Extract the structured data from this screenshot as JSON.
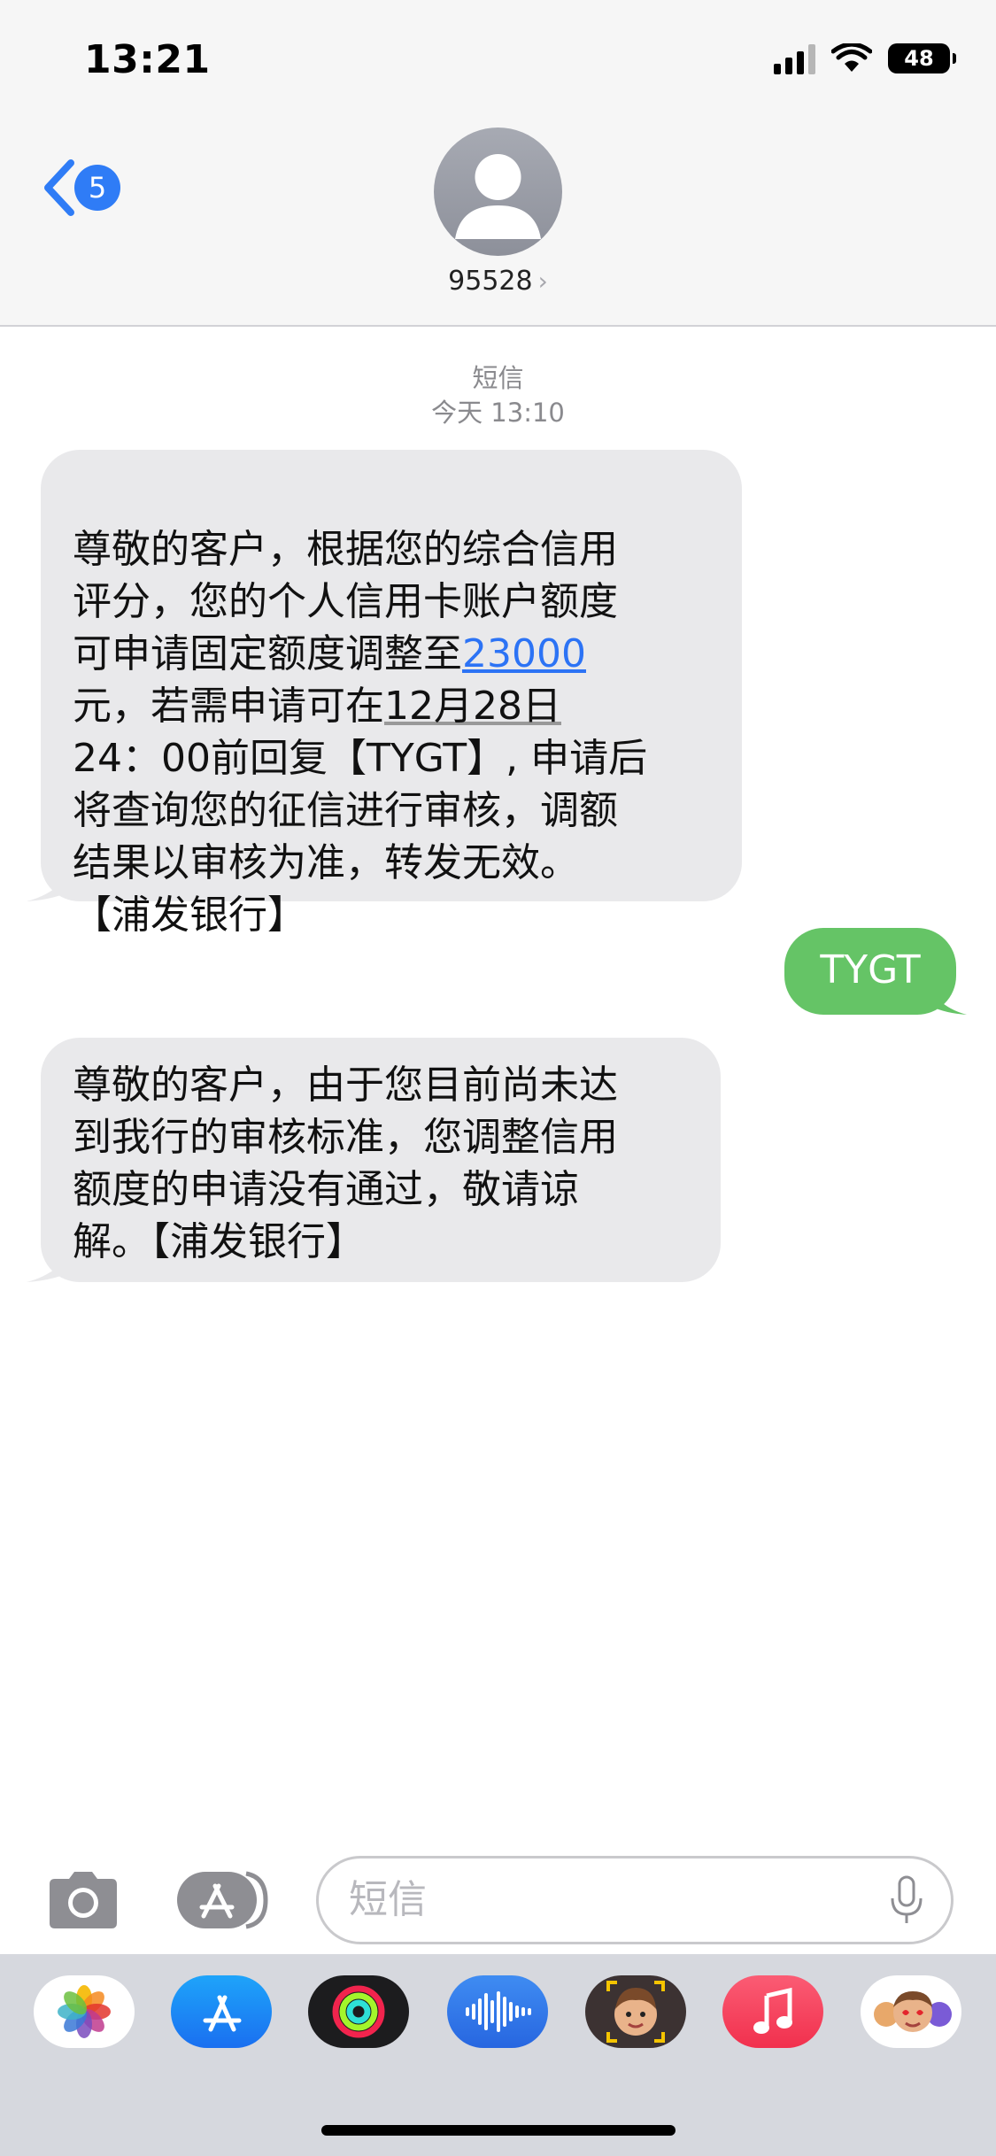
{
  "status": {
    "time": "13:21",
    "battery": "48"
  },
  "nav": {
    "back_badge": "5",
    "contact": "95528"
  },
  "thread": {
    "label": "短信",
    "time": "今天 13:10"
  },
  "messages": {
    "m1": {
      "p1": "尊敬的客户，根据您的综合信用\n评分，您的个人信用卡账户额度\n可申请固定额度调整至",
      "amount": "23000",
      "p2": "\n元，若需申请可在",
      "date": "12月28日",
      "p3": "\n24：00前回复【TYGT】, 申请后\n将查询您的征信进行审核，调额\n结果以审核为准，转发无效。\n【浦发银行】"
    },
    "m2": {
      "text": "TYGT"
    },
    "m3": {
      "text": "尊敬的客户，由于您目前尚未达\n到我行的审核标准，您调整信用\n额度的申请没有通过，敬请谅\n解。【浦发银行】"
    }
  },
  "input": {
    "placeholder": "短信"
  },
  "dock": [
    "photos-app",
    "app-store-app",
    "fitness-app",
    "voice-memos-app",
    "memoji-app",
    "music-app",
    "animoji-app"
  ],
  "colors": {
    "incoming": "#e9e9eb",
    "outgoing": "#65c466",
    "accent": "#2f7cf6"
  }
}
